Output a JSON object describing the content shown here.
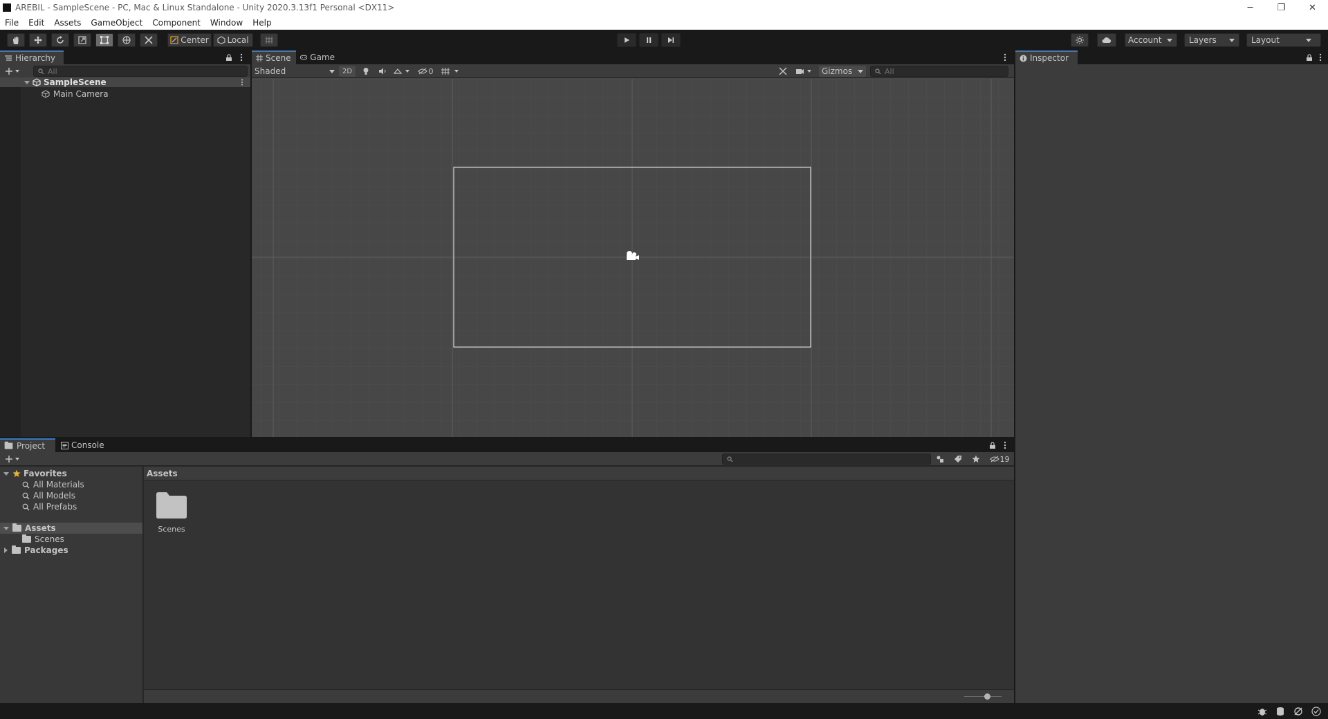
{
  "window": {
    "title": "AREBIL - SampleScene - PC, Mac & Linux Standalone - Unity 2020.3.13f1 Personal <DX11>",
    "minimize": "─",
    "restore": "❐",
    "close": "✕"
  },
  "menu": [
    "File",
    "Edit",
    "Assets",
    "GameObject",
    "Component",
    "Window",
    "Help"
  ],
  "toolbar": {
    "pivot_label": "Center",
    "space_label": "Local",
    "account_label": "Account",
    "layers_label": "Layers",
    "layout_label": "Layout"
  },
  "hierarchy": {
    "tab_label": "Hierarchy",
    "search_placeholder": "All",
    "scene_name": "SampleScene",
    "objects": [
      "Main Camera"
    ]
  },
  "scene_view": {
    "tabs": [
      "Scene",
      "Game"
    ],
    "shading_mode": "Shaded",
    "mode_2d": "2D",
    "hidden_count": "0",
    "gizmos_label": "Gizmos",
    "search_placeholder": "All"
  },
  "inspector": {
    "tab_label": "Inspector"
  },
  "project": {
    "tabs": [
      "Project",
      "Console"
    ],
    "favorites_label": "Favorites",
    "favorites": [
      "All Materials",
      "All Models",
      "All Prefabs"
    ],
    "assets_label": "Assets",
    "asset_folders": [
      "Scenes"
    ],
    "packages_label": "Packages",
    "breadcrumb": "Assets",
    "grid_items": [
      "Scenes"
    ],
    "hidden_packages_count": "19"
  },
  "colors": {
    "background": "#191919",
    "panel": "#282828",
    "scene_bg": "#474747",
    "selection": "#3a79bb"
  }
}
